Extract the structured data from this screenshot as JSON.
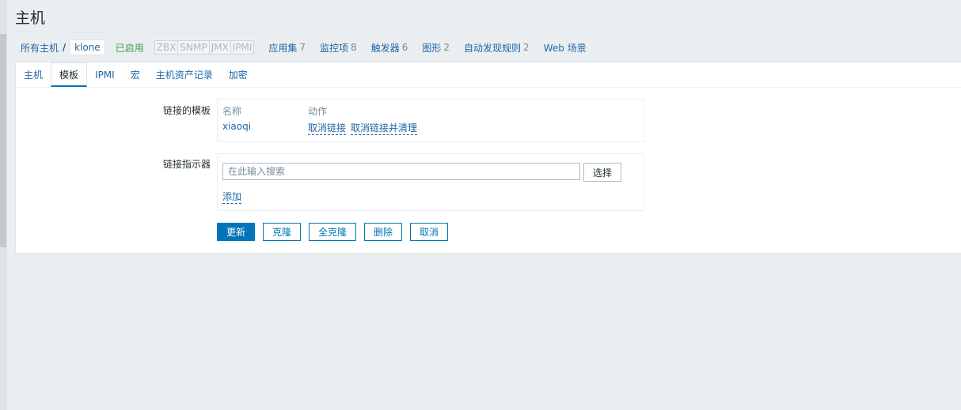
{
  "page": {
    "title": "主机"
  },
  "breadcrumb": {
    "all_hosts": "所有主机",
    "separator": "/",
    "current_host": "klone",
    "status": "已启用",
    "availability": [
      "ZBX",
      "SNMP",
      "JMX",
      "IPMI"
    ],
    "items": [
      {
        "label": "应用集",
        "count": "7"
      },
      {
        "label": "监控项",
        "count": "8"
      },
      {
        "label": "触发器",
        "count": "6"
      },
      {
        "label": "图形",
        "count": "2"
      },
      {
        "label": "自动发现规则",
        "count": "2"
      },
      {
        "label": "Web 场景",
        "count": ""
      }
    ]
  },
  "tabs": [
    "主机",
    "模板",
    "IPMI",
    "宏",
    "主机资产记录",
    "加密"
  ],
  "active_tab": "模板",
  "linked_templates": {
    "label": "链接的模板",
    "col_name": "名称",
    "col_action": "动作",
    "rows": [
      {
        "name": "xiaoqi",
        "unlink": "取消链接",
        "unlink_clear": "取消链接并清理"
      }
    ]
  },
  "link_new": {
    "label": "链接指示器",
    "placeholder": "在此输入搜索",
    "select_label": "选择",
    "add_label": "添加"
  },
  "buttons": {
    "update": "更新",
    "clone": "克隆",
    "full_clone": "全克隆",
    "delete": "删除",
    "cancel": "取消"
  },
  "colors": {
    "accent": "#0275b8",
    "link": "#1f65a6",
    "enabled": "#429e47",
    "background": "#ebeef0"
  }
}
